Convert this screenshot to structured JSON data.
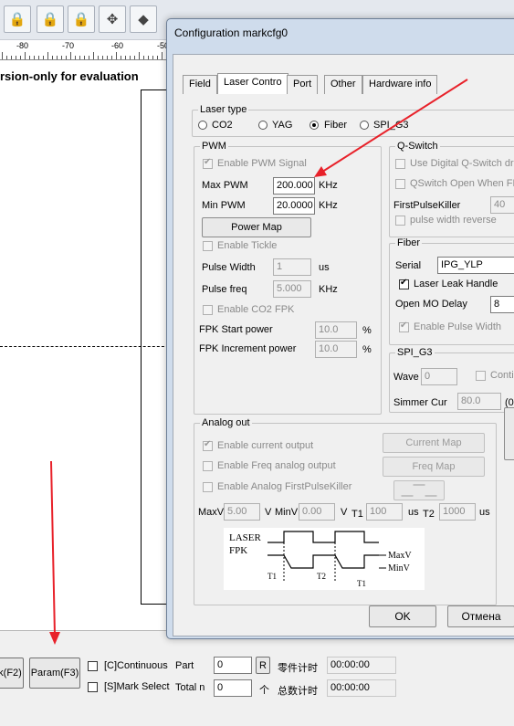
{
  "ruler": {
    "labels": [
      "-80",
      "-70",
      "-60",
      "-50"
    ]
  },
  "canvas": {
    "watermark": "rsion-only for evaluation"
  },
  "bottom": {
    "f2_label": "k(F2)",
    "param_label": "Param(F3)",
    "continuous_label": "[C]Continuous",
    "mark_select_label": "[S]Mark Select",
    "part_label": "Part",
    "part_value": "0",
    "r_label": "R",
    "timer1_label": "零件计时",
    "timer1_value": "00:00:00",
    "total_label": "Total n",
    "total_value": "0",
    "ge_label": "个",
    "timer2_label": "总数计时",
    "timer2_value": "00:00:00"
  },
  "dialog": {
    "title": "Configuration markcfg0",
    "tabs": [
      "Field",
      "Laser Contro",
      "Port",
      "Other",
      "Hardware info"
    ],
    "laser_type": {
      "title": "Laser type",
      "options": [
        "CO2",
        "YAG",
        "Fiber",
        "SPI_G3"
      ],
      "selected": "Fiber"
    },
    "pwm": {
      "title": "PWM",
      "enable_pwm": "Enable PWM Signal",
      "max_pwm_label": "Max PWM",
      "max_pwm_value": "200.000",
      "max_unit": "KHz",
      "min_pwm_label": "Min PWM",
      "min_pwm_value": "20.0000",
      "min_unit": "KHz",
      "power_map": "Power Map",
      "enable_tickle": "Enable Tickle",
      "pulse_width_label": "Pulse Width",
      "pulse_width_value": "1",
      "pulse_width_unit": "us",
      "pulse_freq_label": "Pulse freq",
      "pulse_freq_value": "5.000",
      "pulse_freq_unit": "KHz",
      "enable_co2_fpk": "Enable CO2 FPK",
      "fpk_start_label": "FPK Start power",
      "fpk_start_value": "10.0",
      "fpk_inc_label": "FPK Increment power",
      "fpk_inc_value": "10.0",
      "pct": "%"
    },
    "qswitch": {
      "title": "Q-Switch",
      "use_digital": "Use Digital Q-Switch driv",
      "qswitch_open": "QSwitch Open When FF",
      "fpk_label": "FirstPulseKiller",
      "fpk_value": "40",
      "pulse_width_reverse": "pulse width reverse"
    },
    "fiber": {
      "title": "Fiber",
      "serial_label": "Serial",
      "serial_value": "IPG_YLP",
      "laser_leak": "Laser Leak Handle",
      "open_mo_label": "Open MO Delay",
      "open_mo_value": "8",
      "enable_pulse_width": "Enable Pulse Width"
    },
    "spi": {
      "title": "SPI_G3",
      "wave_label": "Wave",
      "wave_value": "0",
      "conti_label": "Conti",
      "simmer_label": "Simmer Cur",
      "simmer_value": "80.0",
      "simmer_unit": "(0-"
    },
    "analog": {
      "title": "Analog out",
      "enable_current": "Enable current output",
      "enable_freq": "Enable Freq analog output",
      "enable_fpk": "Enable Analog FirstPulseKiller",
      "current_map": "Current Map",
      "freq_map": "Freq Map",
      "maxv_label": "MaxV",
      "maxv_value": "5.00",
      "v1": "V",
      "minv_label": "MinV",
      "minv_value": "0.00",
      "v2": "V",
      "t1_label": "T1",
      "t1_value": "100",
      "us1": "us",
      "t2_label": "T2",
      "t2_value": "1000",
      "us2": "us"
    },
    "diagram": {
      "laser": "LASER",
      "fpk": "FPK",
      "maxv": "MaxV",
      "minv": "MinV",
      "t1": "T1",
      "t2": "T2",
      "t1b": "T1"
    },
    "ok": "OK",
    "cancel": "Отмена"
  },
  "colors": {
    "arrow": "#e8212a",
    "dialog_frame": "#cfdcec"
  }
}
